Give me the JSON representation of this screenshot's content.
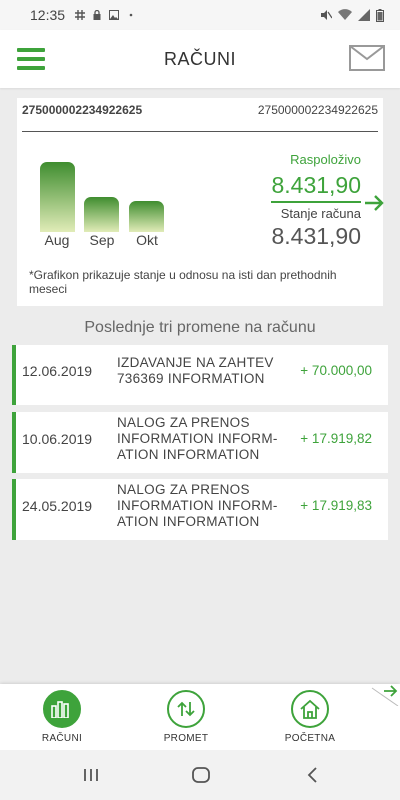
{
  "status_bar": {
    "time": "12:35"
  },
  "header": {
    "title": "RAČUNI"
  },
  "account": {
    "number_left": "275000002234922625",
    "number_right": "275000002234922625",
    "chart": {
      "months": [
        "Aug",
        "Sep",
        "Okt"
      ],
      "relative_levels": [
        1.0,
        0.5,
        0.44
      ],
      "color": "#3ea33b"
    },
    "available_label": "Raspoloživo",
    "available_value": "8.431,90",
    "balance_label": "Stanje računa",
    "balance_value": "8.431,90",
    "chart_note": "*Grafikon prikazuje stanje u odnosu na isti dan prethodnih meseci"
  },
  "recent": {
    "title": "Poslednje tri promene na računu",
    "transactions": [
      {
        "date": "12.06.2019",
        "description": "IZDAVANJE NA ZAHTEV 736369 INFORMATION",
        "amount": "+ 70.000,00"
      },
      {
        "date": "10.06.2019",
        "description": "NALOG ZA PRENOS INFORMATION INFORM- ATION   INFORMATION",
        "amount": "+ 17.919,82"
      },
      {
        "date": "24.05.2019",
        "description": "NALOG ZA PRENOS INFORMATION INFORM- ATION   INFORMATION",
        "amount": "+ 17.919,83"
      }
    ]
  },
  "bottom_nav": {
    "items": [
      {
        "label": "RAČUNI",
        "icon": "bar-chart-icon",
        "active": true
      },
      {
        "label": "PROMET",
        "icon": "transfer-arrows-icon",
        "active": false
      },
      {
        "label": "POČETNA",
        "icon": "home-icon",
        "active": false
      }
    ]
  },
  "colors": {
    "accent": "#3ea33b",
    "background": "#ececec"
  }
}
